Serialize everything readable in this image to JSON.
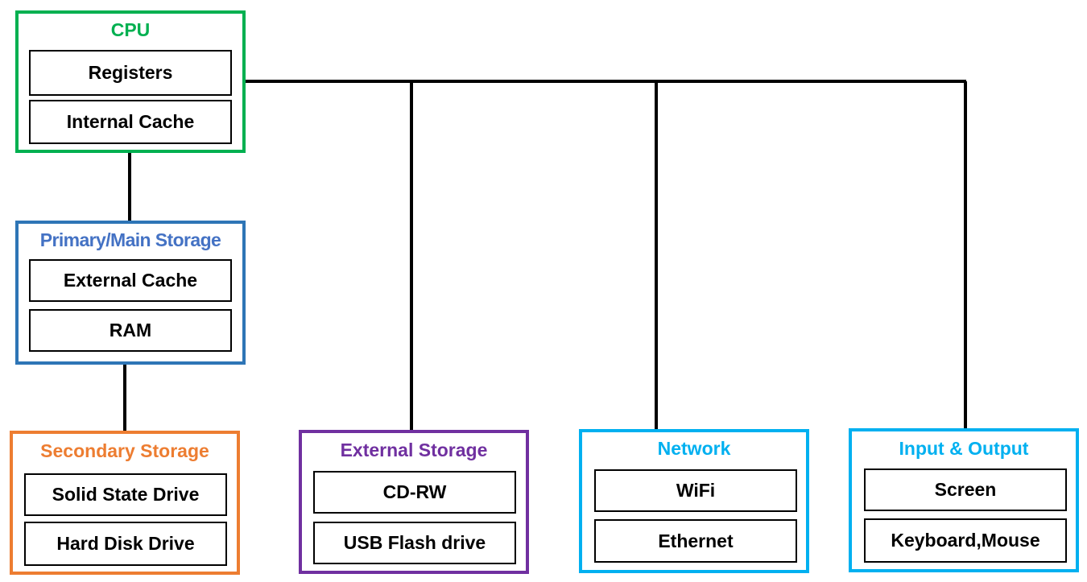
{
  "diagram": {
    "colors": {
      "cpu": "#00b050",
      "primary": "#2e75b6",
      "primary_title": "#4472c4",
      "secondary": "#ed7d31",
      "external": "#7030a0",
      "network": "#00b0f0",
      "io": "#00b0f0",
      "connector": "#000000"
    },
    "groups": {
      "cpu": {
        "title": "CPU",
        "items": [
          "Registers",
          "Internal Cache"
        ]
      },
      "primary": {
        "title": "Primary/Main Storage",
        "items": [
          "External Cache",
          "RAM"
        ]
      },
      "secondary": {
        "title": "Secondary Storage",
        "items": [
          "Solid State Drive",
          "Hard Disk Drive"
        ]
      },
      "external": {
        "title": "External Storage",
        "items": [
          "CD-RW",
          "USB Flash drive"
        ]
      },
      "network": {
        "title": "Network",
        "items": [
          "WiFi",
          "Ethernet"
        ]
      },
      "io": {
        "title": "Input & Output",
        "items": [
          "Screen",
          "Keyboard,Mouse"
        ]
      }
    },
    "connections": [
      [
        "cpu",
        "primary"
      ],
      [
        "primary",
        "secondary"
      ],
      [
        "cpu",
        "external"
      ],
      [
        "cpu",
        "network"
      ],
      [
        "cpu",
        "io"
      ]
    ]
  }
}
